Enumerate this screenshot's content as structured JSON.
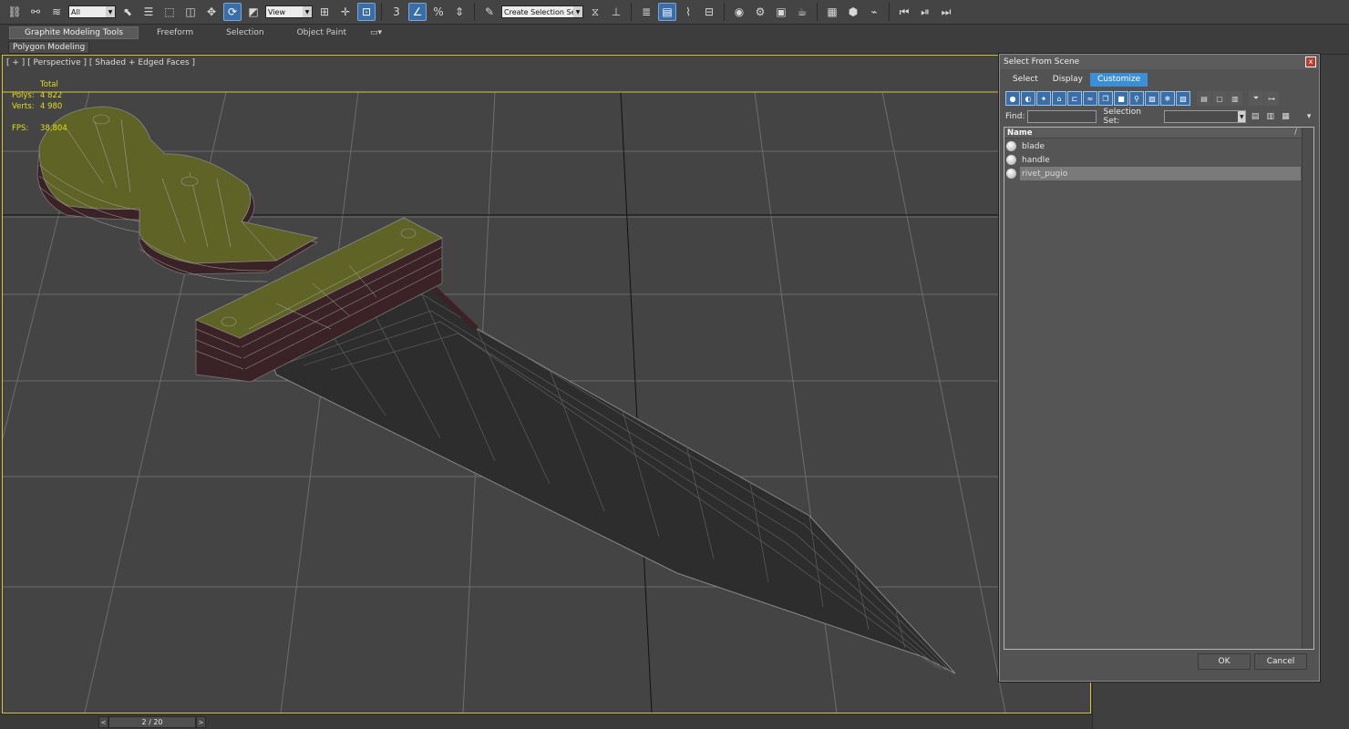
{
  "toolbar": {
    "filter_value": "All",
    "refcoord_value": "View",
    "selection_set_placeholder": "Create Selection Se",
    "snap_label": "3",
    "percent_label": "%"
  },
  "ribbon": {
    "tabs": [
      {
        "label": "Graphite Modeling Tools",
        "active": true
      },
      {
        "label": "Freeform",
        "active": false
      },
      {
        "label": "Selection",
        "active": false
      },
      {
        "label": "Object Paint",
        "active": false
      }
    ],
    "panel_button": "Polygon Modeling"
  },
  "viewport": {
    "label": "[ + ] [ Perspective ] [ Shaded + Edged Faces ]",
    "stats": {
      "header": "Total",
      "polys_label": "Polys:",
      "polys_value": "4 822",
      "verts_label": "Verts:",
      "verts_value": "4 980",
      "fps_label": "FPS:",
      "fps_value": "38,804"
    },
    "colors": {
      "handle": "#5f6426",
      "handle_side": "#3a2226",
      "blade": "#2e2e2e",
      "grid": "#777777",
      "frame": "#d8c337"
    }
  },
  "timeline": {
    "frame_display": "2 / 20",
    "prev": "<",
    "next": ">"
  },
  "dialog": {
    "title": "Select From Scene",
    "close": "x",
    "menu": [
      {
        "label": "Select",
        "active": false
      },
      {
        "label": "Display",
        "active": false
      },
      {
        "label": "Customize",
        "active": true
      }
    ],
    "find_label": "Find:",
    "find_value": "",
    "selection_set_label": "Selection Set:",
    "list_header": "Name",
    "sort_indicator": "/",
    "items": [
      {
        "name": "blade",
        "selected": false
      },
      {
        "name": "handle",
        "selected": false
      },
      {
        "name": "rivet_pugio",
        "selected": true
      }
    ],
    "ok_label": "OK",
    "cancel_label": "Cancel"
  }
}
